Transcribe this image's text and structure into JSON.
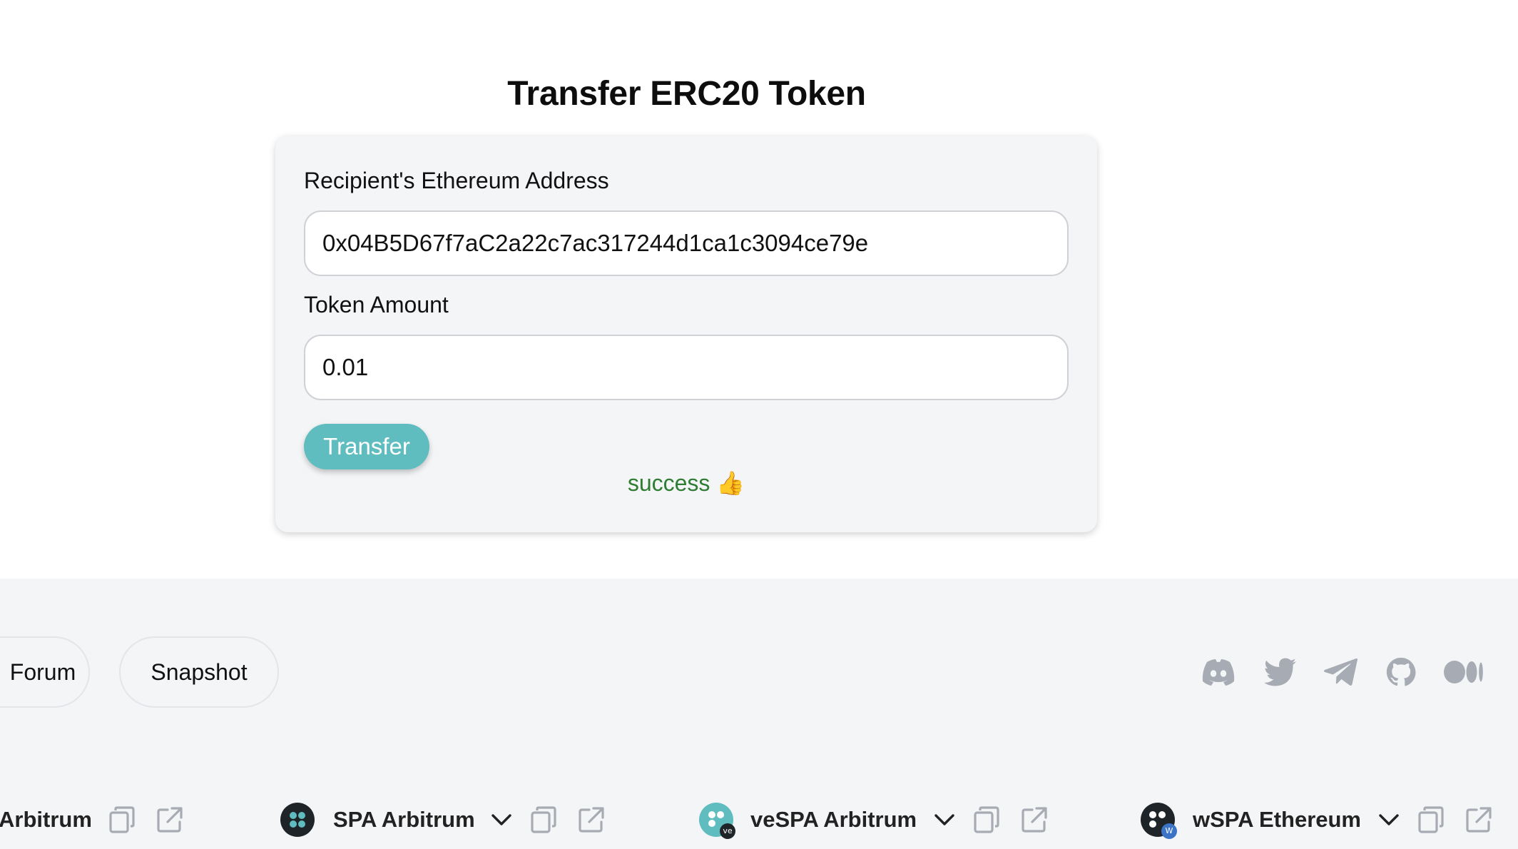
{
  "page": {
    "title": "Transfer ERC20 Token"
  },
  "form": {
    "recipient_label": "Recipient's Ethereum Address",
    "recipient_value": "0x04B5D67f7aC2a22c7ac317244d1ca1c3094ce79e",
    "amount_label": "Token Amount",
    "amount_value": "0.01",
    "transfer_label": "Transfer",
    "status": "success 👍",
    "status_color": "#2e7d32",
    "button_color": "#5fbcbf"
  },
  "footer": {
    "links": [
      {
        "label": "Forum"
      },
      {
        "label": "Snapshot"
      }
    ],
    "social_icons": [
      "discord-icon",
      "twitter-icon",
      "telegram-icon",
      "github-icon",
      "medium-icon"
    ],
    "tokens": [
      {
        "name": "Arbitrum"
      },
      {
        "name": "SPA Arbitrum",
        "logo": "spa-logo"
      },
      {
        "name": "veSPA Arbitrum",
        "logo": "vespa-logo"
      },
      {
        "name": "wSPA Ethereum",
        "logo": "wspa-logo"
      }
    ],
    "icon_color": "#a7abb3"
  }
}
